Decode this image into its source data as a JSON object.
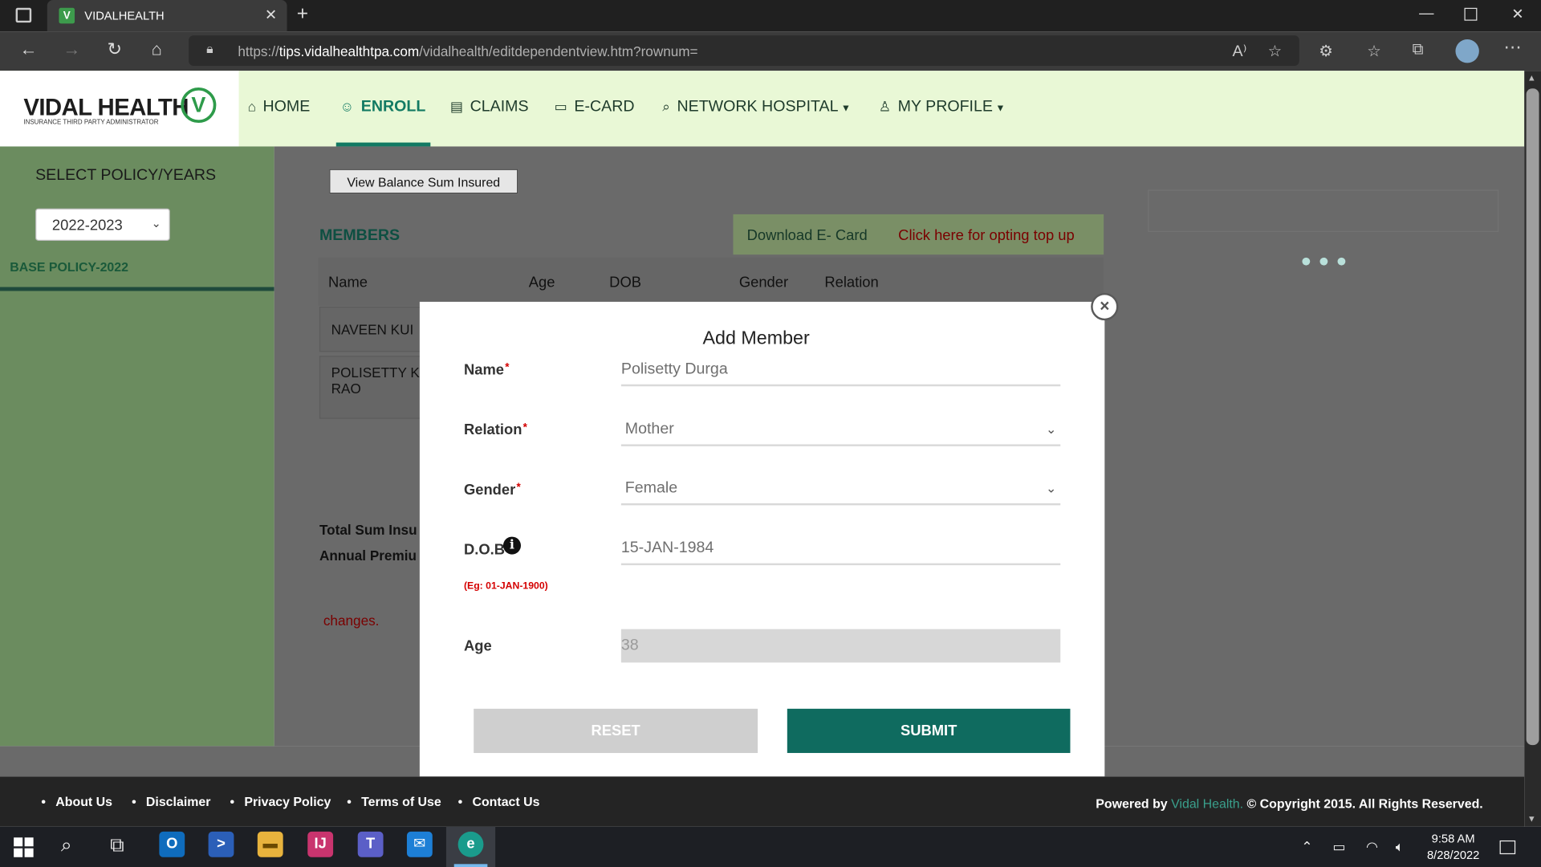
{
  "browser": {
    "tab_title": "VIDALHEALTH",
    "tab_favicon": "V",
    "url_prefix": "https://",
    "url_domain": "tips.vidalhealthtpa.com",
    "url_path": "/vidalhealth/editdependentview.htm?rownum="
  },
  "header": {
    "logo_text": "VIDAL HEALTH",
    "logo_tagline": "INSURANCE THIRD PARTY ADMINISTRATOR",
    "logo_mark": "V",
    "nav": {
      "home": "HOME",
      "enroll": "ENROLL",
      "claims": "CLAIMS",
      "ecard": "E-CARD",
      "network": "NETWORK HOSPITAL",
      "profile": "MY PROFILE"
    },
    "active_nav": "ENROLL",
    "accent_color": "#127a63"
  },
  "sidebar": {
    "title": "SELECT POLICY/YEARS",
    "selected_year": "2022-2023",
    "policy_label": "BASE POLICY-2022"
  },
  "main": {
    "balance_button": "View Balance Sum Insured",
    "members_title": "MEMBERS",
    "download_ecard": "Download E- Card",
    "topup_link": "Click here for opting top up",
    "table_headers": [
      "Name",
      "Age",
      "DOB",
      "Gender",
      "Relation"
    ],
    "rows": [
      {
        "name": "NAVEEN KUI"
      },
      {
        "name_line1": "POLISETTY K",
        "name_line2": "RAO"
      }
    ],
    "total_sum_label": "Total Sum Insu",
    "annual_premium_label": "Annual Premiu",
    "changes_text": "changes."
  },
  "modal": {
    "title": "Add Member",
    "name_label": "Name",
    "name_value": "Polisetty Durga",
    "relation_label": "Relation",
    "relation_value": "Mother",
    "gender_label": "Gender",
    "gender_value": "Female",
    "dob_label": "D.O.B",
    "dob_value": "15-JAN-1984",
    "dob_hint": "(Eg: 01-JAN-1900)",
    "age_label": "Age",
    "age_value": "38",
    "required_mark": "*",
    "reset_label": "RESET",
    "submit_label": "SUBMIT",
    "close_glyph": "×"
  },
  "footer": {
    "links": [
      "About Us",
      "Disclaimer",
      "Privacy Policy",
      "Terms of Use",
      "Contact Us"
    ],
    "powered_by": "Powered by",
    "brand": "Vidal Health.",
    "copyright": "© Copyright 2015. All Rights Reserved."
  },
  "taskbar": {
    "time": "9:58 AM",
    "date": "8/28/2022"
  }
}
